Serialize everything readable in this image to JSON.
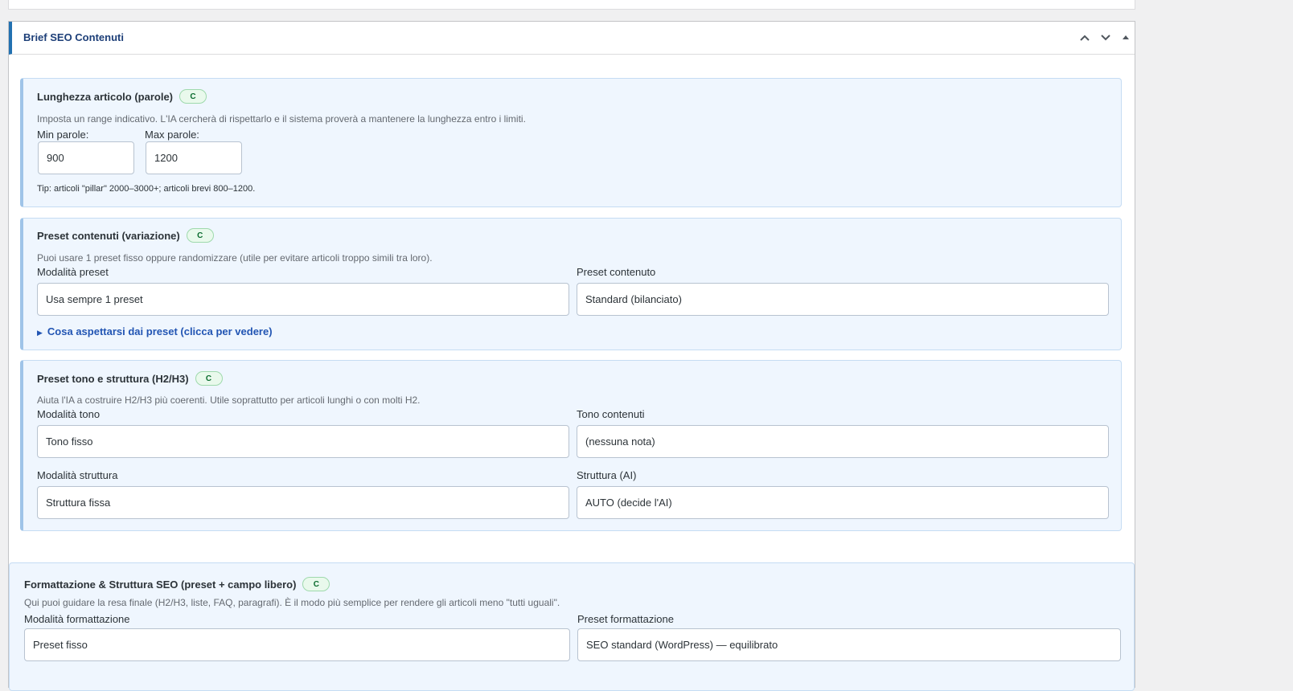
{
  "metabox": {
    "title": "Brief SEO Contenuti"
  },
  "badge": "C",
  "length": {
    "title": "Lunghezza articolo (parole)",
    "desc": "Imposta un range indicativo. L'IA cercherà di rispettarlo e il sistema proverà a mantenere la lunghezza entro i limiti.",
    "min_label": "Min parole:",
    "min_value": "900",
    "max_label": "Max parole:",
    "max_value": "1200",
    "tip": "Tip: articoli \"pillar\" 2000–3000+; articoli brevi 800–1200."
  },
  "content_preset": {
    "title": "Preset contenuti (variazione)",
    "desc": "Puoi usare 1 preset fisso oppure randomizzare (utile per evitare articoli troppo simili tra loro).",
    "mode_label": "Modalità preset",
    "mode_value": "Usa sempre 1 preset",
    "preset_label": "Preset contenuto",
    "preset_value": "Standard (bilanciato)",
    "disclosure": "Cosa aspettarsi dai preset (clicca per vedere)"
  },
  "tone_structure": {
    "title": "Preset tono e struttura (H2/H3)",
    "desc": "Aiuta l'IA a costruire H2/H3 più coerenti. Utile soprattutto per articoli lunghi o con molti H2.",
    "tone_mode_label": "Modalità tono",
    "tone_mode_value": "Tono fisso",
    "tone_label": "Tono contenuti",
    "tone_value": "(nessuna nota)",
    "structure_mode_label": "Modalità struttura",
    "structure_mode_value": "Struttura fissa",
    "structure_label": "Struttura (AI)",
    "structure_value": "AUTO (decide l'AI)"
  },
  "formatting": {
    "title": "Formattazione & Struttura SEO (preset + campo libero)",
    "desc": "Qui puoi guidare la resa finale (H2/H3, liste, FAQ, paragrafi). È il modo più semplice per rendere gli articoli meno \"tutti uguali\".",
    "mode_label": "Modalità formattazione",
    "mode_value": "Preset fisso",
    "preset_label": "Preset formattazione",
    "preset_value": "SEO standard (WordPress) — equilibrato"
  }
}
